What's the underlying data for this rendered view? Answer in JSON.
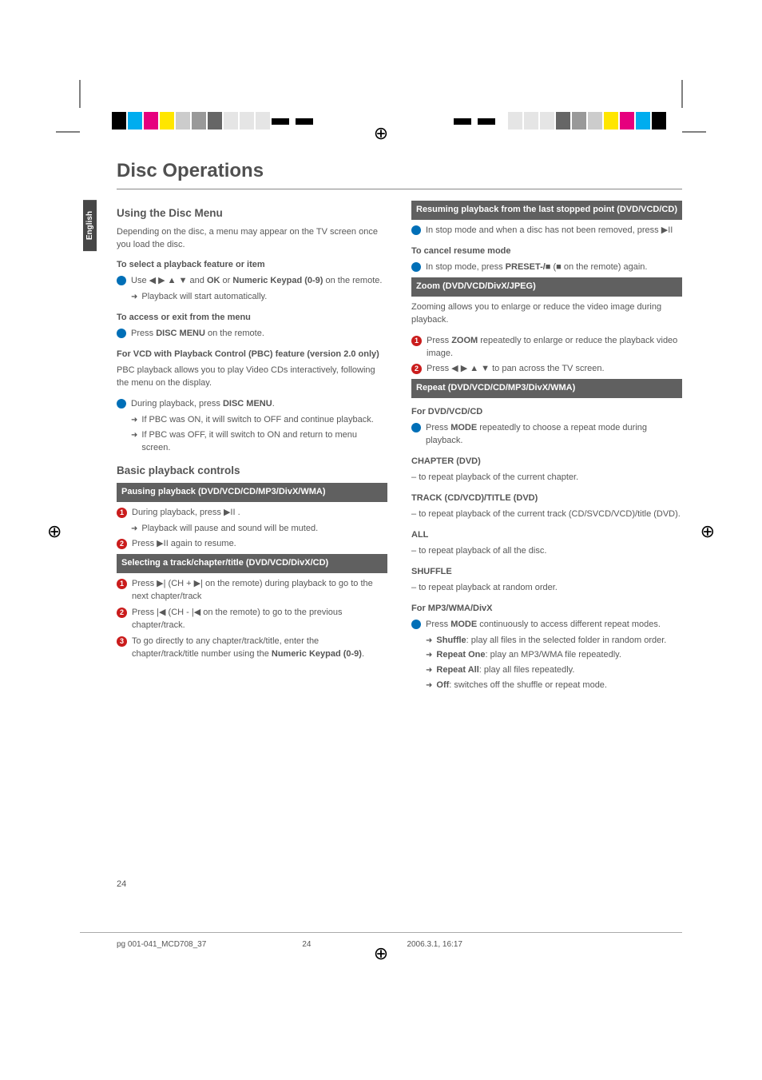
{
  "doc": {
    "title": "Disc Operations",
    "language_tab": "English",
    "page_number": "24",
    "footer_file": "pg 001-041_MCD708_37",
    "footer_page": "24",
    "footer_date": "2006.3.1, 16:17"
  },
  "col1": {
    "h2_using": "Using the Disc Menu",
    "using_intro": "Depending on the disc, a menu may appear on the TV screen once you load the disc.",
    "h3_select": "To select a playback feature or item",
    "select_line_pre": "Use ◀ ▶ ▲ ▼ and ",
    "select_ok": "OK",
    "select_or": " or ",
    "select_numeric": "Numeric Keypad (0-9)",
    "select_suffix": " on the remote.",
    "select_arrow": "Playback will start automatically.",
    "h3_access": "To access or exit from the menu",
    "access_pre": "Press ",
    "access_bold": "DISC MENU",
    "access_suf": " on the remote.",
    "h3_vcd": "For VCD with Playback Control (PBC) feature (version 2.0 only)",
    "vcd_intro": "PBC playback allows you to play Video CDs interactively, following the menu on the display.",
    "vcd_line_pre": "During playback, press ",
    "vcd_line_bold": "DISC MENU",
    "vcd_line_suf": ".",
    "vcd_arrow1": "If PBC was ON, it will switch to OFF and continue playback.",
    "vcd_arrow2": "If PBC was OFF, it will switch to ON and return to menu screen.",
    "h2_basic": "Basic playback controls",
    "bar_pause": "Pausing playback (DVD/VCD/CD/MP3/DivX/WMA)",
    "pause_1_pre": "During playback, press  ▶II .",
    "pause_1_arrow": "Playback will pause and sound will be muted.",
    "pause_2": "Press  ▶II again to resume.",
    "bar_select": "Selecting a track/chapter/title (DVD/VCD/DivX/CD)",
    "sel_1": "Press ▶| (CH + ▶| on the remote) during playback to go to the next chapter/track",
    "sel_2": "Press |◀ (CH - |◀ on the remote) to go to the previous chapter/track.",
    "sel_3_pre": "To go directly to any chapter/track/title, enter the chapter/track/title number using the ",
    "sel_3_bold": "Numeric Keypad (0-9)",
    "sel_3_suf": "."
  },
  "col2": {
    "bar_resume": "Resuming playback from the last stopped point (DVD/VCD/CD)",
    "resume_1": "In stop mode and when a disc has not been removed, press ▶II",
    "h3_cancel": "To cancel resume mode",
    "cancel_pre": "In stop mode, press ",
    "cancel_bold": "PRESET-/■",
    "cancel_mid": " (■ on the remote) again.",
    "bar_zoom": "Zoom (DVD/VCD/DivX/JPEG)",
    "zoom_intro": "Zooming allows you to enlarge or reduce the video image during playback.",
    "zoom_1_pre": "Press ",
    "zoom_1_bold": "ZOOM",
    "zoom_1_suf": " repeatedly to enlarge or reduce the playback video image.",
    "zoom_2": "Press ◀ ▶ ▲ ▼ to pan across the TV screen.",
    "bar_repeat": "Repeat (DVD/VCD/CD/MP3/DivX/WMA)",
    "h3_dvdcd": "For DVD/VCD/CD",
    "rep_1_pre": "Press ",
    "rep_1_bold": "MODE",
    "rep_1_suf": " repeatedly to choose a repeat mode during playback.",
    "h3_chapter": "CHAPTER (DVD)",
    "chapter_line": "to repeat playback of the current chapter.",
    "h3_track": "TRACK (CD/VCD)/TITLE (DVD)",
    "track_line": "to repeat playback of the current track (CD/SVCD/VCD)/title (DVD).",
    "h3_all": "ALL",
    "all_line": "to repeat playback of all the disc.",
    "h3_shuffle": "SHUFFLE",
    "shuffle_line": "to repeat playback at random order.",
    "h3_mp3": "For MP3/WMA/DivX",
    "mp3_1_pre": "Press ",
    "mp3_1_bold": "MODE",
    "mp3_1_suf": " continuously to access different repeat modes.",
    "mp3_shuf_b": "Shuffle",
    "mp3_shuf": ": play all files in the selected folder in random order.",
    "mp3_rep1_b": "Repeat One",
    "mp3_rep1": ": play an MP3/WMA file repeatedly.",
    "mp3_repa_b": "Repeat All",
    "mp3_repa": ": play all files repeatedly.",
    "mp3_off_b": "Off",
    "mp3_off": ": switches off the shuffle or repeat mode."
  }
}
